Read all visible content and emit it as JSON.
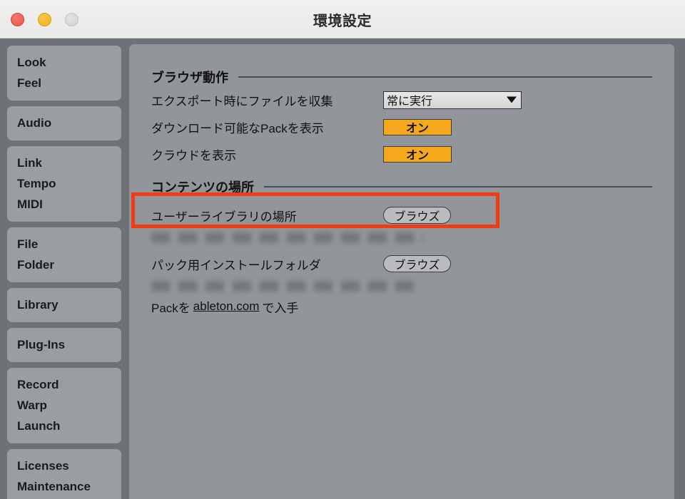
{
  "window": {
    "title": "環境設定",
    "traffic_lights": [
      {
        "name": "close",
        "color": "#e9544b"
      },
      {
        "name": "minimize",
        "color": "#f0b01f"
      },
      {
        "name": "zoom",
        "color": "#d2d2d2"
      }
    ]
  },
  "sidebar": {
    "groups": [
      {
        "items": [
          "Look",
          "Feel"
        ]
      },
      {
        "items": [
          "Audio"
        ]
      },
      {
        "items": [
          "Link",
          "Tempo",
          "MIDI"
        ]
      },
      {
        "items": [
          "File",
          "Folder"
        ]
      },
      {
        "items": [
          "Library"
        ]
      },
      {
        "items": [
          "Plug-Ins"
        ]
      },
      {
        "items": [
          "Record",
          "Warp",
          "Launch"
        ]
      },
      {
        "items": [
          "Licenses",
          "Maintenance"
        ]
      }
    ]
  },
  "main": {
    "sections": [
      {
        "title": "ブラウザ動作",
        "rows": [
          {
            "label": "エクスポート時にファイルを収集",
            "control": "dropdown",
            "value": "常に実行"
          },
          {
            "label": "ダウンロード可能なPackを表示",
            "control": "toggle",
            "value": "オン"
          },
          {
            "label": "クラウドを表示",
            "control": "toggle",
            "value": "オン"
          }
        ]
      },
      {
        "title": "コンテンツの場所",
        "rows": [
          {
            "label": "ユーザーライブラリの場所",
            "control": "pill",
            "value": "ブラウズ",
            "path_redacted": true
          },
          {
            "label": "パック用インストールフォルダ",
            "control": "pill",
            "value": "ブラウズ",
            "path_redacted": true
          }
        ],
        "link_row": {
          "prefix": "Packを",
          "link": "ableton.com",
          "suffix": "で入手"
        }
      }
    ]
  },
  "annotation": {
    "highlight_color": "#f03c16",
    "target_row_label": "クラウドを表示"
  }
}
